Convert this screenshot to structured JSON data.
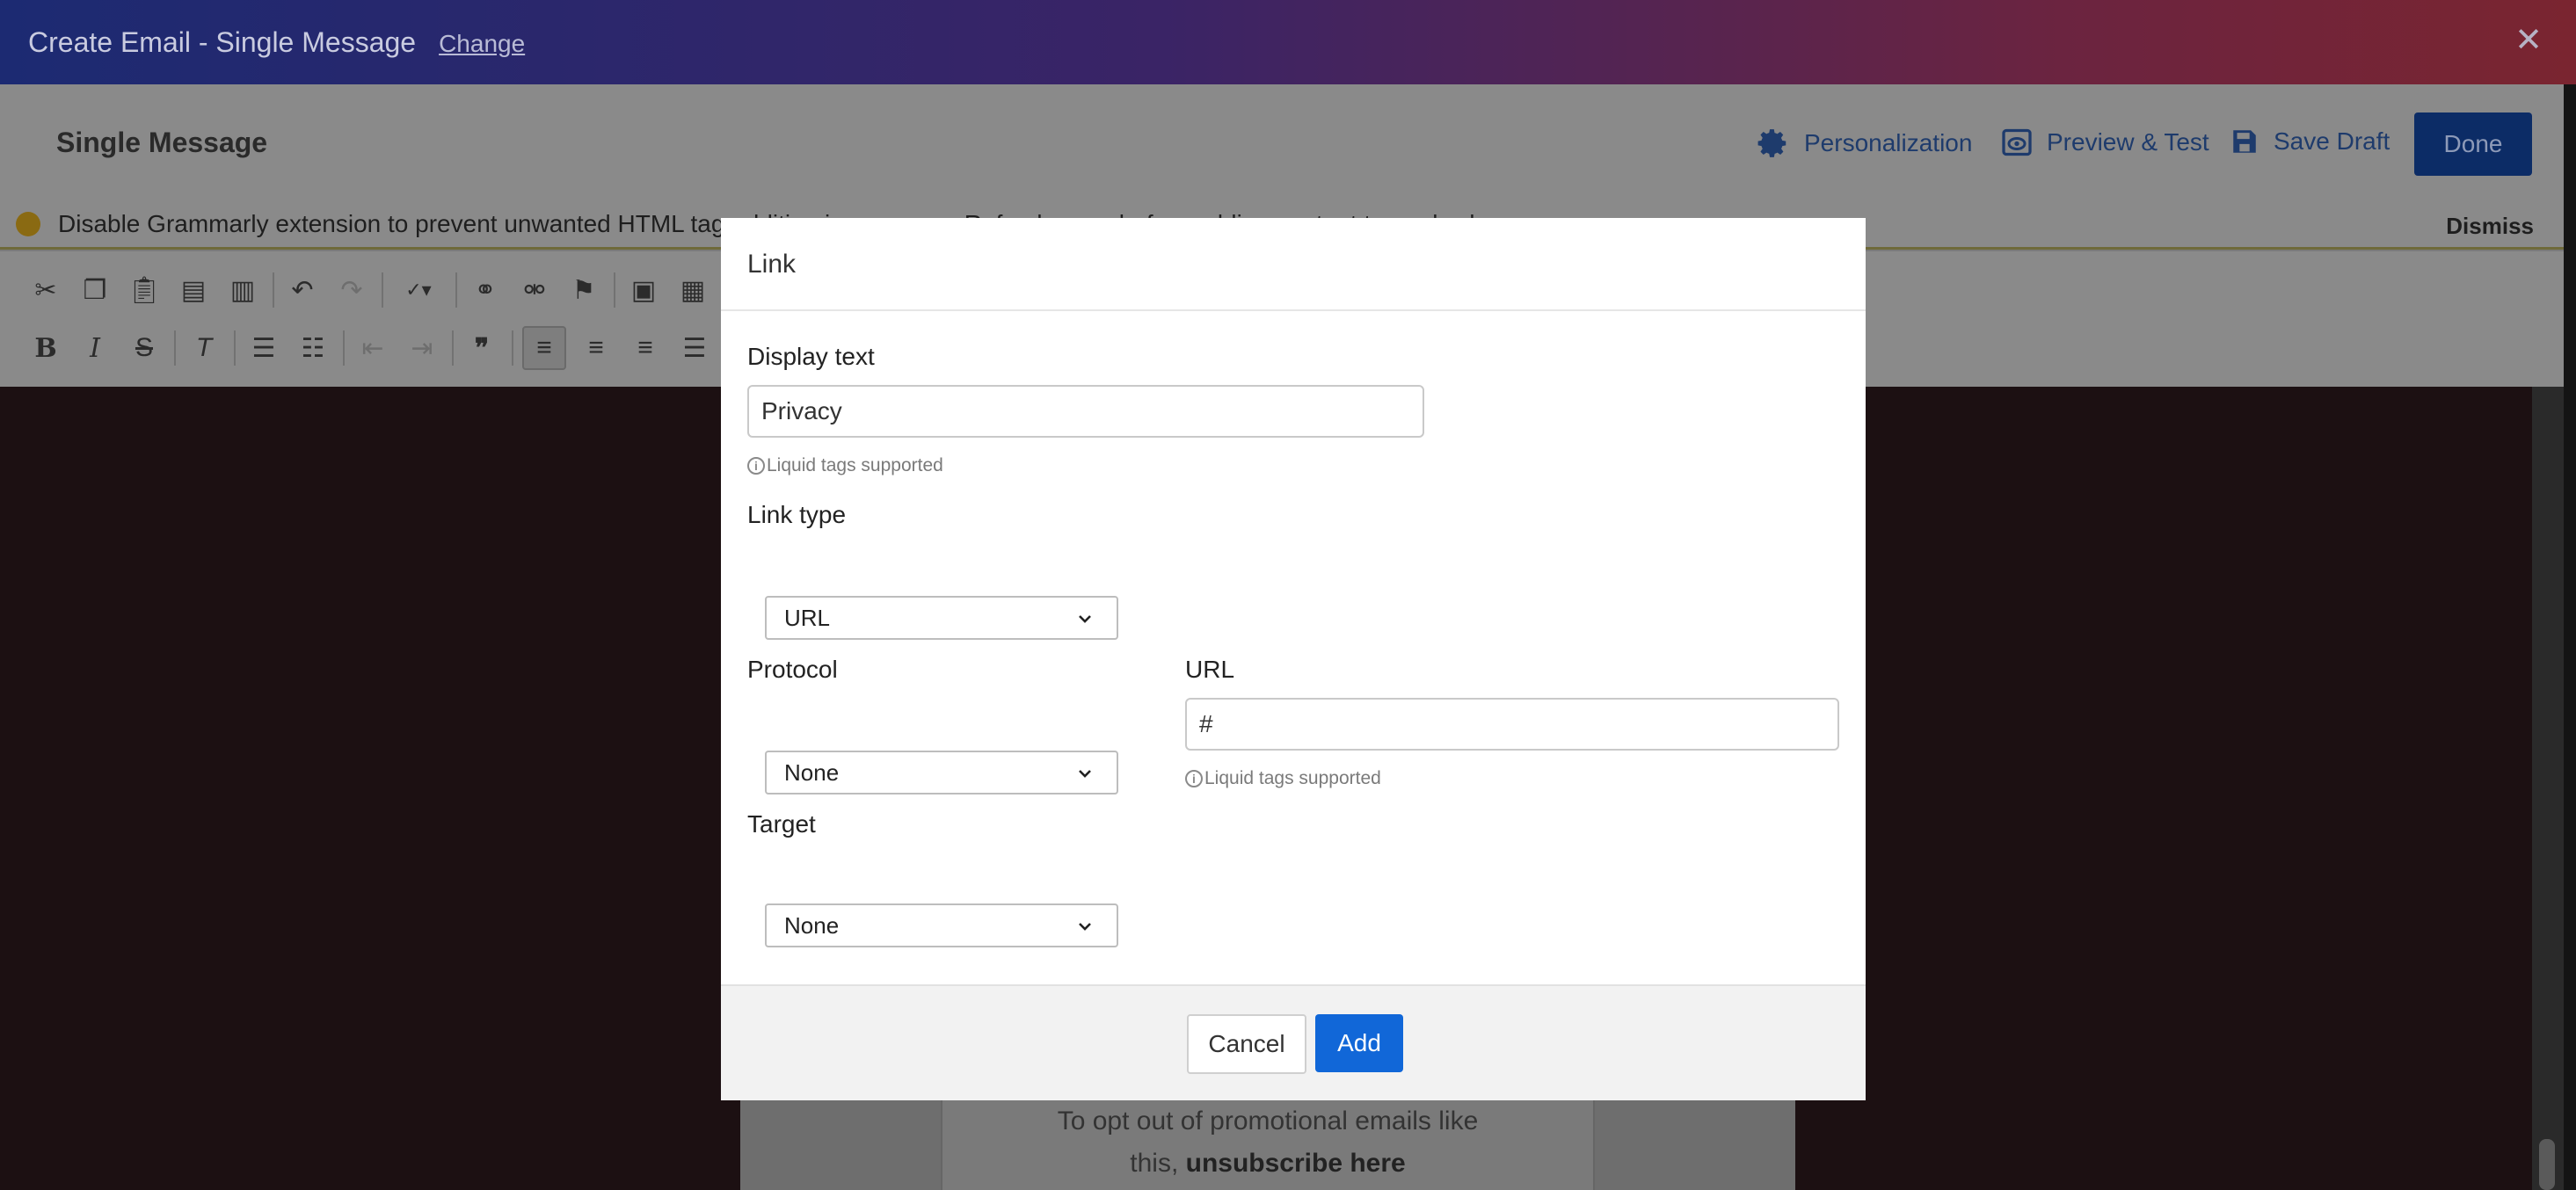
{
  "window": {
    "title": "Create Email - Single Message",
    "change_link": "Change"
  },
  "header": {
    "page_name": "Single Message",
    "personalization": "Personalization",
    "preview_test": "Preview & Test",
    "save_draft": "Save Draft",
    "done": "Done"
  },
  "notice": {
    "message": "Disable Grammarly extension to prevent unwanted HTML tag addition in message. Refresh page before adding content to apply changes.",
    "dismiss": "Dismiss"
  },
  "toolbar": {
    "row1": [
      "cut-icon",
      "copy-icon",
      "paste-icon",
      "paste-text-icon",
      "paste-word-icon",
      "undo-icon",
      "redo-icon",
      "spellcheck-icon",
      "link-icon",
      "unlink-icon",
      "anchor-icon",
      "image-icon",
      "table-icon"
    ],
    "row2": [
      "bold-icon",
      "italic-icon",
      "strikethrough-icon",
      "remove-format-icon",
      "numbered-list-icon",
      "bulleted-list-icon",
      "decrease-indent-icon",
      "increase-indent-icon",
      "blockquote-icon",
      "align-left-icon",
      "align-center-icon",
      "align-right-icon",
      "justify-icon"
    ]
  },
  "email_preview": {
    "line1": "To opt out of promotional emails like",
    "line2_prefix": "this, ",
    "line2_link": "unsubscribe here"
  },
  "dialog": {
    "title": "Link",
    "display_text_label": "Display text",
    "display_text_value": "Privacy",
    "liquid_hint": "Liquid tags supported",
    "link_type_label": "Link type",
    "link_type_value": "URL",
    "protocol_label": "Protocol",
    "protocol_value": "None",
    "url_label": "URL",
    "url_value": "#",
    "target_label": "Target",
    "target_value": "None",
    "cancel": "Cancel",
    "add": "Add"
  },
  "colors": {
    "primary_button": "#1167d8",
    "done_button": "#0c2c66"
  }
}
